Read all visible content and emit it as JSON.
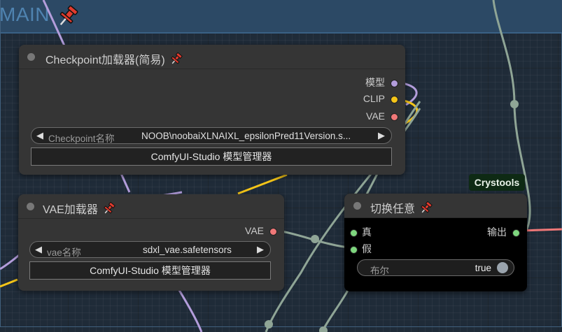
{
  "group": {
    "title": "MAIN"
  },
  "checkpoint_node": {
    "title": "Checkpoint加载器(简易)",
    "outputs": [
      {
        "label": "模型",
        "color": "#b39ddb"
      },
      {
        "label": "CLIP",
        "color": "#f5c518"
      },
      {
        "label": "VAE",
        "color": "#f07878"
      }
    ],
    "ckpt_widget": {
      "label": "Checkpoint名称",
      "value": "NOOB\\noobaiXLNAIXL_epsilonPred11Version.s..."
    },
    "manager_button": "ComfyUI-Studio 模型管理器"
  },
  "vae_node": {
    "title": "VAE加载器",
    "outputs": [
      {
        "label": "VAE",
        "color": "#f07878"
      }
    ],
    "vae_widget": {
      "label": "vae名称",
      "value": "sdxl_vae.safetensors"
    },
    "manager_button": "ComfyUI-Studio 模型管理器"
  },
  "switch_node": {
    "badge": "Crystools",
    "title": "切换任意",
    "inputs": [
      {
        "label": "真",
        "color": "#7ed67e"
      },
      {
        "label": "假",
        "color": "#7ed67e"
      }
    ],
    "outputs": [
      {
        "label": "输出",
        "color": "#7ed67e"
      }
    ],
    "bool_widget": {
      "label": "布尔",
      "value": "true"
    }
  },
  "colors": {
    "canvas": "#1f2b38",
    "group_header": "#2c4965",
    "node_bg": "#353535",
    "switch_bg": "#000000",
    "wire_any": "#8fa596",
    "wire_model": "#b39ddb",
    "wire_clip": "#f5c518",
    "wire_vae": "#f07878"
  }
}
